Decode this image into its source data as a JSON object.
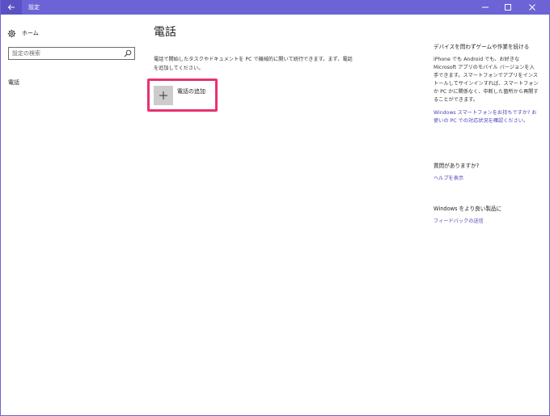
{
  "titlebar": {
    "title": "設定"
  },
  "nav": {
    "home_label": "ホーム",
    "search_placeholder": "設定の検索",
    "phone_label": "電話"
  },
  "main": {
    "title": "電話",
    "description": "電話で開始したタスクやドキュメントを PC で機械的に開いて続行できます。まず、電話を追加してください。",
    "add_phone_label": "電話の追加"
  },
  "right_panel": {
    "section1": {
      "heading": "デバイスを問わずゲームや作業を続ける",
      "body": "iPhone でも Android でも、お好きな Microsoft アプリのモバイル バージョンを入手できます。スマートフォンでアプリをインストールしてサインインすれば、スマートフォンか PC かに関係なく、中断した箇所から再開することができます。",
      "link": "Windows スマートフォンをお持ちですか? お使いの PC での対応状況を確認ください。"
    },
    "section2": {
      "heading": "質問がありますか?",
      "link": "ヘルプを表示"
    },
    "section3": {
      "heading": "Windows をより良い製品に",
      "link": "フィードバックの送信"
    }
  },
  "colors": {
    "titlebar": "#6b63d6",
    "highlight": "#e8336e",
    "link": "#4a43b8"
  },
  "icons": {
    "back": "back-arrow-icon",
    "minimize": "minimize-icon",
    "maximize": "maximize-icon",
    "close": "close-icon",
    "home": "gear-icon",
    "search": "search-icon",
    "add": "plus-icon"
  }
}
